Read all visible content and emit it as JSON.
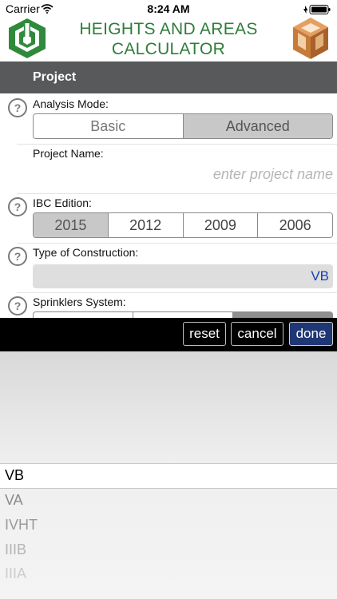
{
  "status_bar": {
    "carrier": "Carrier",
    "time": "8:24 AM"
  },
  "header": {
    "title_line1": "HEIGHTS AND AREAS",
    "title_line2": "CALCULATOR",
    "logo_icon": "app-logo-icon",
    "box_icon": "3d-box-icon"
  },
  "section": {
    "title": "Project"
  },
  "analysis_mode": {
    "label": "Analysis Mode:",
    "options": [
      "Basic",
      "Advanced"
    ],
    "selected": "Advanced"
  },
  "project_name": {
    "label": "Project Name:",
    "placeholder": "enter project name"
  },
  "ibc_edition": {
    "label": "IBC Edition:",
    "options": [
      "2015",
      "2012",
      "2009",
      "2006"
    ],
    "selected": "2015"
  },
  "construction": {
    "label": "Type of Construction:",
    "value": "VB"
  },
  "sprinklers": {
    "label": "Sprinklers System:"
  },
  "toolbar": {
    "reset_label": "reset",
    "cancel_label": "cancel",
    "done_label": "done"
  },
  "picker": {
    "selected": "VB",
    "options": [
      "VA",
      "IVHT",
      "IIIB",
      "IIIA"
    ]
  },
  "colors": {
    "title_green": "#2f7d3a",
    "section_bar": "#58595b",
    "done_button": "#1f3774",
    "value_blue": "#1a3fb0"
  }
}
